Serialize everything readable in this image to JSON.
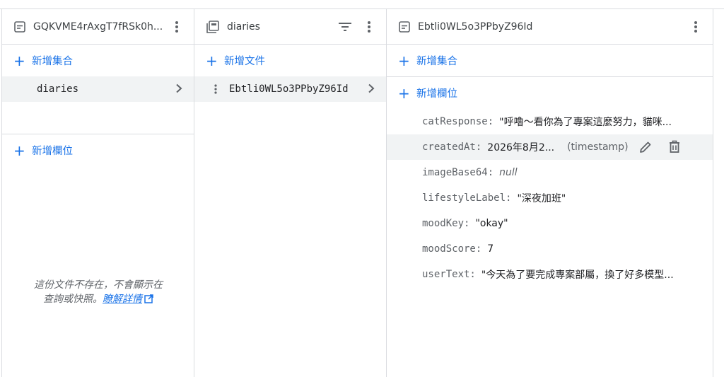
{
  "panel1": {
    "title": "GQKVME4rAxgT7fRSk0h...",
    "add_collection": "新增集合",
    "collections": [
      {
        "label": "diaries"
      }
    ],
    "add_field": "新增欄位",
    "notice_line1": "這份文件不存在，不會顯示在",
    "notice_line2": "查詢或快照。",
    "notice_link": "瞭解詳情"
  },
  "panel2": {
    "title": "diaries",
    "add_document": "新增文件",
    "documents": [
      {
        "label": "Ebtli0WL5o3PPbyZ96Id"
      }
    ]
  },
  "panel3": {
    "title": "Ebtli0WL5o3PPbyZ96Id",
    "add_collection": "新增集合",
    "add_field": "新增欄位",
    "fields": [
      {
        "key": "catResponse:",
        "value": "\"呼嚕～看你為了專案這麼努力，貓咪..."
      },
      {
        "key": "createdAt:",
        "value": "2026年8月2...",
        "type": "(timestamp)"
      },
      {
        "key": "imageBase64:",
        "value": "null"
      },
      {
        "key": "lifestyleLabel:",
        "value": "\"深夜加班\""
      },
      {
        "key": "moodKey:",
        "value": "\"okay\""
      },
      {
        "key": "moodScore:",
        "value": "7"
      },
      {
        "key": "userText:",
        "value": "\"今天為了要完成專案部屬，換了好多模型..."
      }
    ]
  },
  "colors": {
    "accent": "#1a73e8",
    "border": "#dadce0",
    "selected_bg": "#f1f3f4",
    "muted": "#5f6368"
  }
}
